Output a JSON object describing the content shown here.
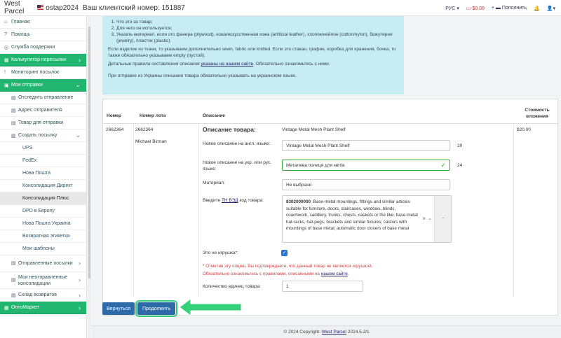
{
  "header": {
    "brand": "West Parcel",
    "user": "ostap2024",
    "client_number_label": "Ваш клиентский номер: 151887",
    "lang": "РУС",
    "balance": "$0.00",
    "add_label": "Пополнить"
  },
  "sidebar": {
    "items": [
      {
        "label": "Главная",
        "icon": "home-icon"
      },
      {
        "label": "Помощь",
        "icon": "question-icon"
      },
      {
        "label": "Служба поддержки",
        "icon": "support-icon"
      },
      {
        "label": "Калькулятор пересылки",
        "icon": "calculator-icon"
      },
      {
        "label": "Мониторинг посылок",
        "icon": "alert-icon"
      },
      {
        "label": "Мои отправки",
        "icon": "box-icon"
      },
      {
        "label": "Отследить отправление",
        "icon": "track-icon"
      },
      {
        "label": "Адрес отправителя",
        "icon": "address-icon"
      },
      {
        "label": "Товар для отправки",
        "icon": "goods-icon"
      },
      {
        "label": "Создать посылку",
        "icon": "create-icon"
      },
      {
        "label": "UPS"
      },
      {
        "label": "FedEx"
      },
      {
        "label": "Нова Пошта"
      },
      {
        "label": "Консолидация Директ"
      },
      {
        "label": "Консолидация Плюс"
      },
      {
        "label": "DPD в Европу"
      },
      {
        "label": "Нова Пошта Украина"
      },
      {
        "label": "Возвратная этикетка"
      },
      {
        "label": "Мои шаблоны"
      },
      {
        "label": "Отправленные посылки",
        "icon": "sent-icon"
      },
      {
        "label": "Мои неотправленные консолидации",
        "icon": "pending-icon"
      },
      {
        "label": "Склад возвратов",
        "icon": "warehouse-icon"
      },
      {
        "label": "ОптоМаркет",
        "icon": "market-icon"
      }
    ]
  },
  "info": {
    "list": [
      "Что это за товар;",
      "Для чего он используется;",
      "Указать материал, если это фанера (plywood), кожа/искусственная кожа (artificial leather), хлопок/нейлон (cotton/nylon), бижутерия (jewelry), пластик (plastic)."
    ],
    "para1": "Если изделие из ткани, то указываем дополнительно sewn, fabric или knitted. Если это стакан, графин, коробка для хранения, бочка, то также обязательно указываем empty (пустой).",
    "para2_pre": "Детальные правила составления описания",
    "para2_link": "указаны на нашем сайте",
    "para2_post": ". Обязательно ознакомьтесь с ними.",
    "para3": "При отправке из Украины описание товара обязательно указывать на украинском языке."
  },
  "table": {
    "headers": [
      "Номер",
      "Номер лота",
      "Описание",
      "Стоимость вложения"
    ],
    "row": {
      "number": "2662364",
      "lot": "2662364",
      "recipient": "Michael Birman",
      "value": "$20.00"
    }
  },
  "form": {
    "section_title": "Описание товара:",
    "original_description": "Vintage Metal Mesh Plant Shelf",
    "en_label": "Новое описание на англ. языке:",
    "en_value": "Vintage Metal Mesh Plant Shelf",
    "en_count": "20",
    "ua_label": "Новое описание на укр. или рус. языке:",
    "ua_value": "Металева полиця для квітів",
    "ua_count": "24",
    "material_label": "Материал:",
    "material_value": "Не выбрано",
    "tnved_pre": "Введите",
    "tnved_link": "ТН ВЭД",
    "tnved_post": "код товара:",
    "tnved_code": "8302000000",
    "tnved_text": ": Base-metal mountings, fittings and similar articles suitable for furniture, doors, staircases, windows, blinds, coachwork, saddlery, trunks, chests, caskets or the like; base-metal hat-racks, hat-pegs, brackets and similar fixtures; castors with mountings of base metal; automatic door closers of base metal",
    "toy_label": "Это не игрушка*:",
    "warn1": "* Отметив эту опцию, Вы подтверждаете, что данный товар не является игрушкой.",
    "warn2_pre": "Обязательно ознакомьтесь с правилами, описанными на",
    "warn2_link": "нашем сайте",
    "qty_label": "Количество единиц товара:",
    "qty_value": "1"
  },
  "buttons": {
    "back": "Вернуться",
    "continue": "Продолжить"
  },
  "footer": {
    "pre": "© 2024 Copyright:",
    "link": "West Parcel",
    "version": "2024.5.2/1"
  },
  "colors": {
    "green": "#21b66f",
    "button_blue": "#2e6aa8",
    "info_bg": "#c7ecf4",
    "highlight": "#35d07a"
  }
}
